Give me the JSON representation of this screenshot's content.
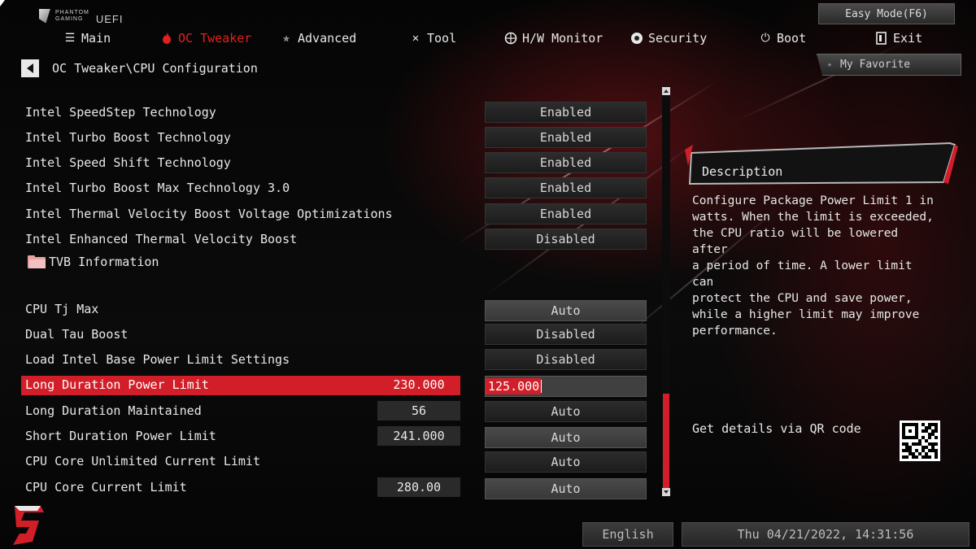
{
  "brand": {
    "line1": "PHANTOM",
    "line2": "GAMING",
    "uefi": "UEFI"
  },
  "easy_mode_label": "Easy Mode(F6)",
  "nav": [
    {
      "label": "Main",
      "icon": "list-icon",
      "active": false
    },
    {
      "label": "OC Tweaker",
      "icon": "flame-icon",
      "active": true
    },
    {
      "label": "Advanced",
      "icon": "star-icon",
      "active": false
    },
    {
      "label": "Tool",
      "icon": "wrench-icon",
      "active": false
    },
    {
      "label": "H/W Monitor",
      "icon": "monitor-icon",
      "active": false
    },
    {
      "label": "Security",
      "icon": "shield-icon",
      "active": false
    },
    {
      "label": "Boot",
      "icon": "power-icon",
      "active": false
    },
    {
      "label": "Exit",
      "icon": "exit-icon",
      "active": false
    }
  ],
  "breadcrumb": "OC Tweaker\\CPU Configuration",
  "my_favorite_label": "My Favorite",
  "settings": [
    {
      "label": "Intel SpeedStep Technology",
      "current": "",
      "option": "Enabled"
    },
    {
      "label": "Intel Turbo Boost Technology",
      "current": "",
      "option": "Enabled"
    },
    {
      "label": "Intel Speed Shift Technology",
      "current": "",
      "option": "Enabled"
    },
    {
      "label": "Intel Turbo Boost Max Technology 3.0",
      "current": "",
      "option": "Enabled"
    },
    {
      "label": "Intel Thermal Velocity Boost Voltage Optimizations",
      "current": "",
      "option": "Enabled"
    },
    {
      "label": "Intel Enhanced Thermal Velocity Boost",
      "current": "",
      "option": "Disabled"
    },
    {
      "label": "TVB Information",
      "current": "",
      "option": ""
    },
    {
      "label": "CPU Tj Max",
      "current": "",
      "option": "Auto"
    },
    {
      "label": "Dual Tau Boost",
      "current": "",
      "option": "Disabled"
    },
    {
      "label": "Load Intel Base Power Limit Settings",
      "current": "",
      "option": "Disabled"
    },
    {
      "label": "Long Duration Power Limit",
      "current": "230.000",
      "option": "125.000"
    },
    {
      "label": "Long Duration Maintained",
      "current": "56",
      "option": "Auto"
    },
    {
      "label": "Short Duration Power Limit",
      "current": "241.000",
      "option": "Auto"
    },
    {
      "label": "CPU Core Unlimited Current Limit",
      "current": "",
      "option": "Auto"
    },
    {
      "label": "CPU Core Current Limit",
      "current": "280.00",
      "option": "Auto"
    }
  ],
  "description": {
    "title": "Description",
    "text": "Configure Package Power Limit 1 in\nwatts. When the limit is exceeded,\nthe CPU ratio will be lowered after\na period of time. A lower limit can\nprotect the CPU and save power,\nwhile a higher limit may improve\nperformance."
  },
  "qr_label": "Get details via QR code",
  "footer": {
    "language": "English",
    "datetime": "Thu 04/21/2022, 14:31:56"
  },
  "colors": {
    "accent": "#d21e28",
    "active_nav": "#e02020"
  }
}
